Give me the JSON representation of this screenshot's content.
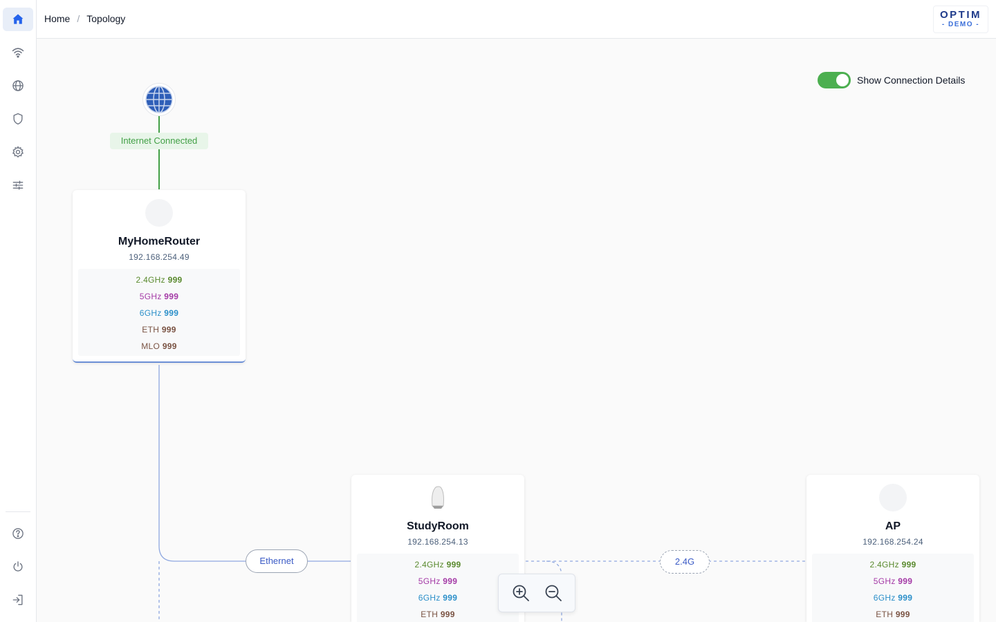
{
  "breadcrumb": {
    "home": "Home",
    "separator": "/",
    "current": "Topology"
  },
  "logo": {
    "line1": "OPTIM",
    "line2": "- DEMO -"
  },
  "sidebar": {
    "top_items": [
      "home-icon",
      "wifi-icon",
      "globe-icon",
      "shield-icon",
      "gear-icon",
      "sliders-icon"
    ],
    "bottom_items": [
      "help-icon",
      "power-icon",
      "logout-icon"
    ],
    "active": "home-icon"
  },
  "toggle": {
    "label": "Show Connection Details",
    "on": true
  },
  "internet": {
    "status": "Internet Connected"
  },
  "devices": {
    "router": {
      "name": "MyHomeRouter",
      "ip": "192.168.254.49",
      "bands": {
        "g24": "2.4GHz",
        "g24_val": "999",
        "g5": "5GHz",
        "g5_val": "999",
        "g6": "6GHz",
        "g6_val": "999",
        "eth": "ETH",
        "eth_val": "999",
        "mlo": "MLO",
        "mlo_val": "999"
      }
    },
    "study": {
      "name": "StudyRoom",
      "ip": "192.168.254.13",
      "bands": {
        "g24": "2.4GHz",
        "g24_val": "999",
        "g5": "5GHz",
        "g5_val": "999",
        "g6": "6GHz",
        "g6_val": "999",
        "eth": "ETH",
        "eth_val": "999"
      }
    },
    "ap": {
      "name": "AP",
      "ip": "192.168.254.24",
      "bands": {
        "g24": "2.4GHz",
        "g24_val": "999",
        "g5": "5GHz",
        "g5_val": "999",
        "g6": "6GHz",
        "g6_val": "999",
        "eth": "ETH",
        "eth_val": "999"
      }
    }
  },
  "edges": {
    "ethernet": "Ethernet",
    "wifi24": "2.4G"
  },
  "colors": {
    "accent": "#2563eb",
    "toggle_on": "#4caf50",
    "internet": "#43a047",
    "link": "#6b8fd6"
  }
}
